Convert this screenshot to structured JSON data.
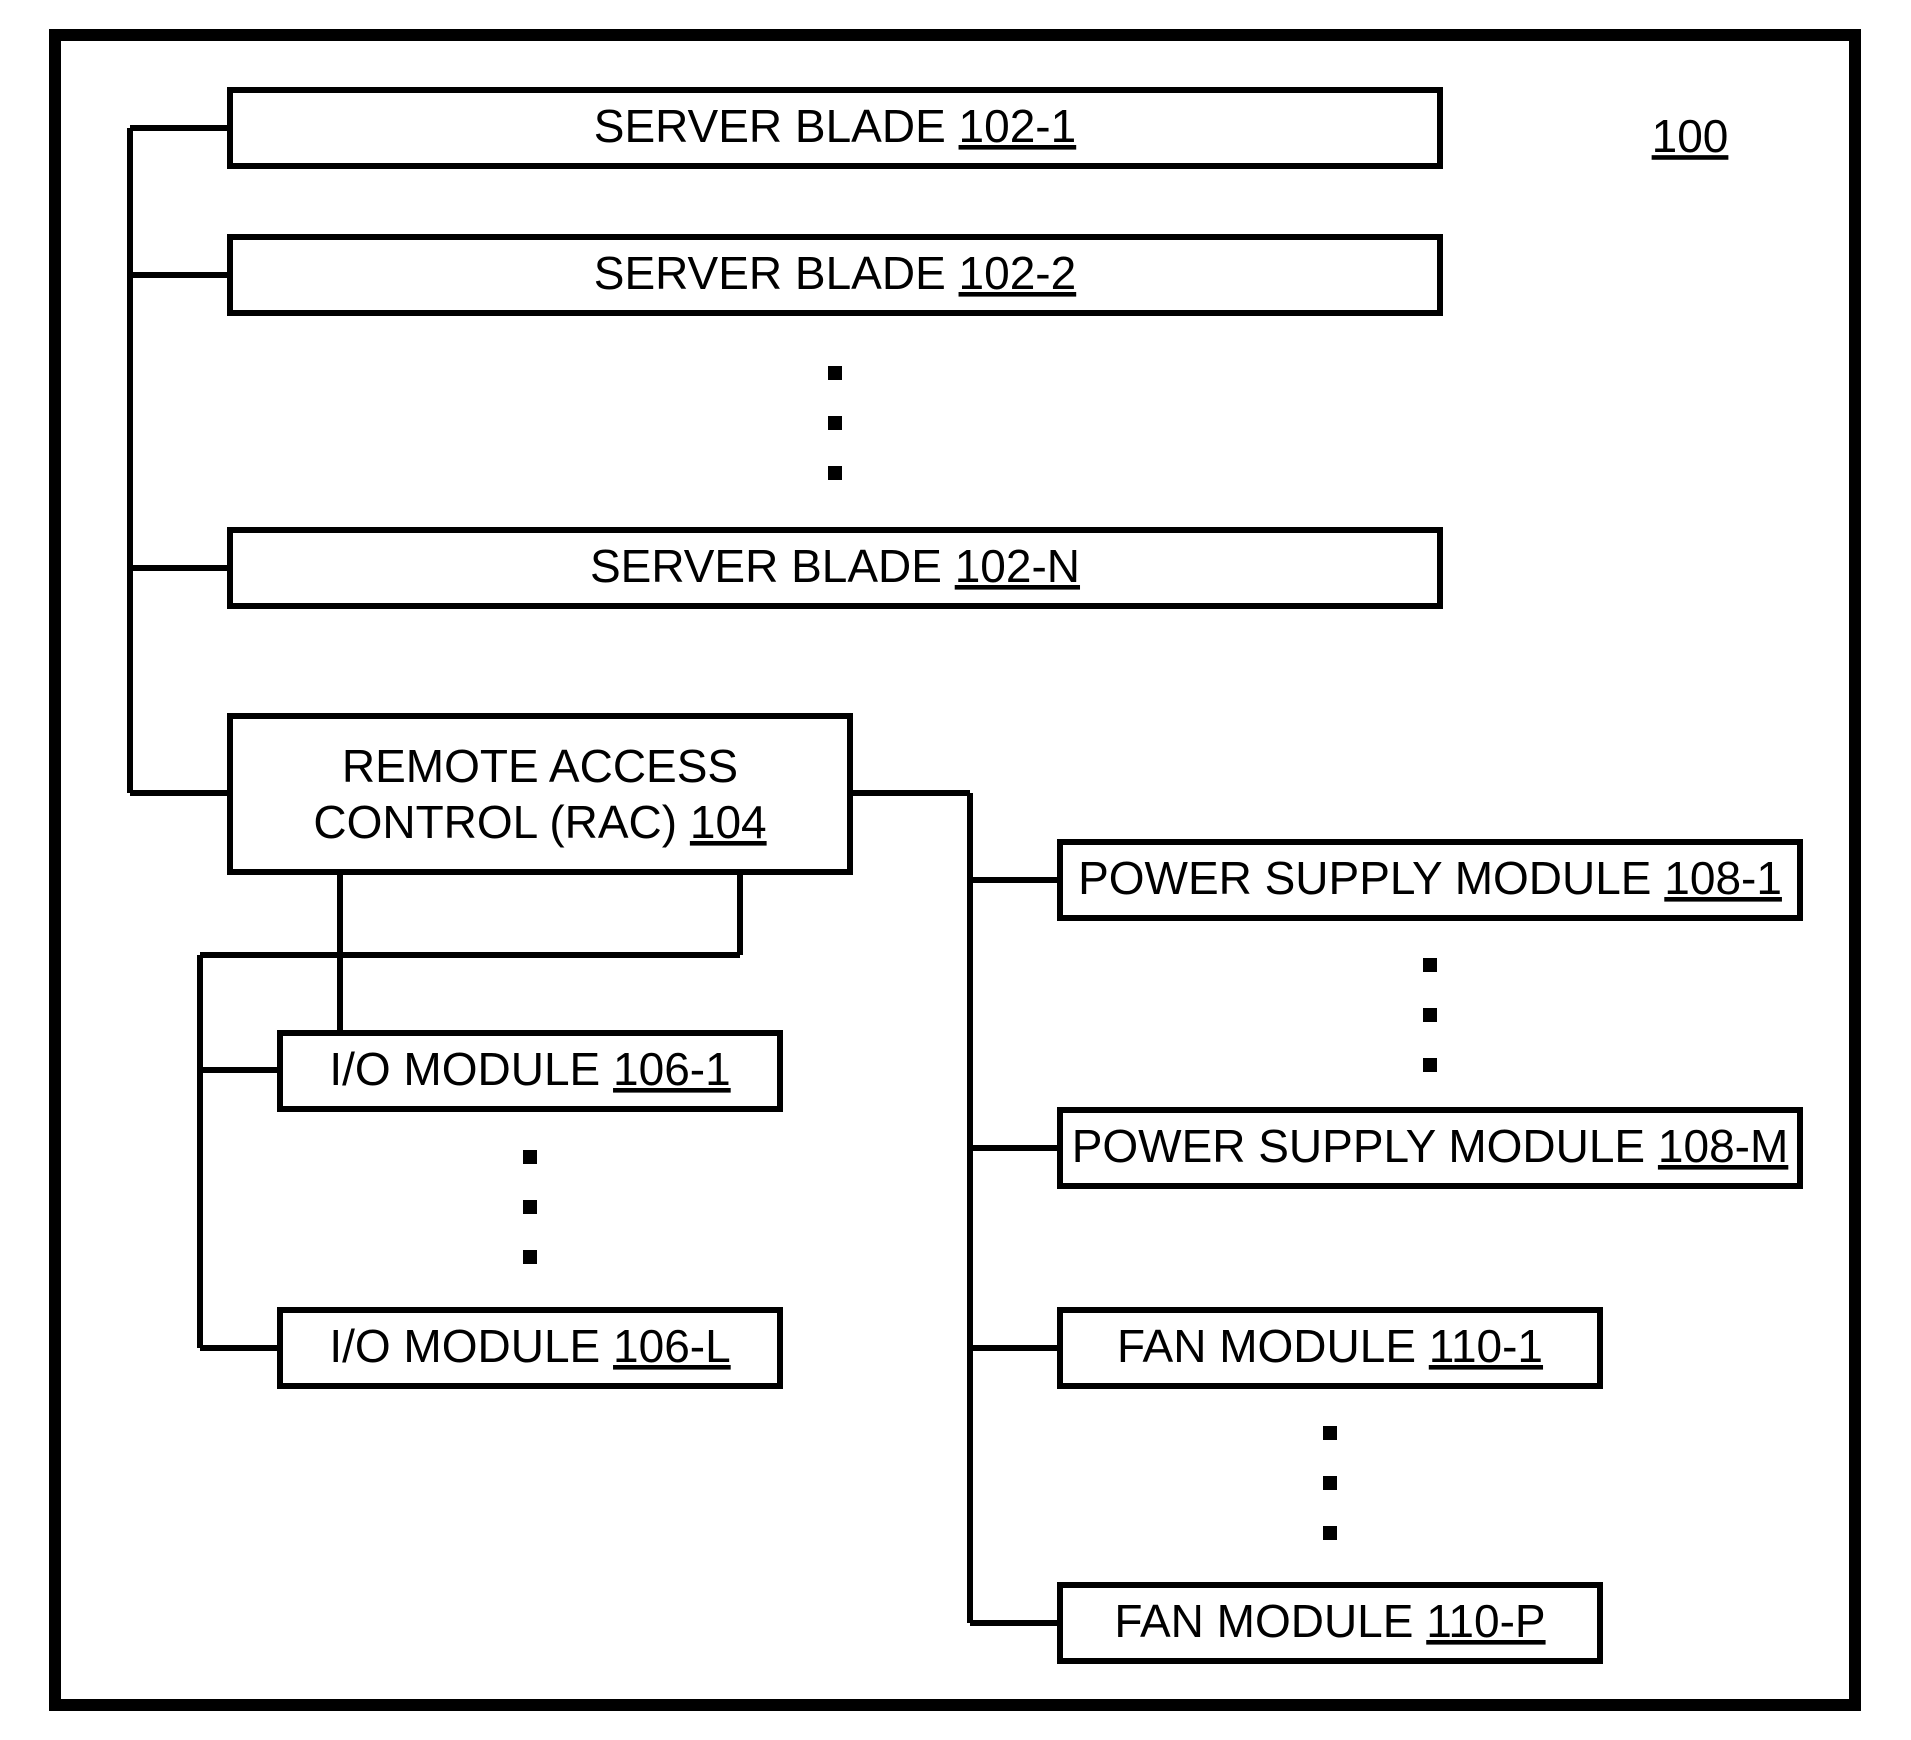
{
  "outer_ref": "100",
  "server_blade": {
    "label": "SERVER BLADE",
    "refs": [
      "102-1",
      "102-2",
      "102-N"
    ]
  },
  "rac": {
    "line1": "REMOTE ACCESS",
    "line2_prefix": "CONTROL (RAC)",
    "ref": "104"
  },
  "io": {
    "label": "I/O MODULE",
    "refs": [
      "106-1",
      "106-L"
    ]
  },
  "psu": {
    "label": "POWER SUPPLY MODULE",
    "refs": [
      "108-1",
      "108-M"
    ]
  },
  "fan": {
    "label": "FAN MODULE",
    "refs": [
      "110-1",
      "110-P"
    ]
  }
}
